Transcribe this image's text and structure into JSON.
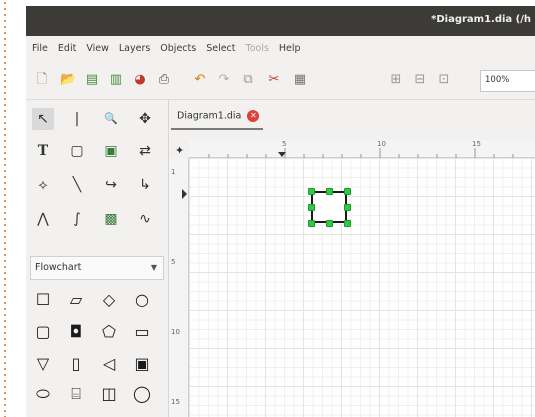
{
  "window": {
    "title": "*Diagram1.dia (/h"
  },
  "menubar": {
    "items": [
      {
        "label": "File",
        "enabled": true
      },
      {
        "label": "Edit",
        "enabled": true
      },
      {
        "label": "View",
        "enabled": true
      },
      {
        "label": "Layers",
        "enabled": true
      },
      {
        "label": "Objects",
        "enabled": true
      },
      {
        "label": "Select",
        "enabled": true
      },
      {
        "label": "Tools",
        "enabled": false
      },
      {
        "label": "Help",
        "enabled": true
      }
    ]
  },
  "toolbar": {
    "zoom_value": "100%",
    "buttons": [
      "new-icon",
      "open-icon",
      "save-icon",
      "save-as-icon",
      "export-icon",
      "print-icon",
      "undo-icon",
      "redo-icon",
      "copy-icon",
      "cut-icon",
      "paste-icon",
      "zoom-in-icon",
      "zoom-out-icon",
      "zoom-fit-icon"
    ]
  },
  "toolbox": {
    "tools": [
      {
        "name": "pointer-tool-icon",
        "glyph": "↖"
      },
      {
        "name": "text-edit-tool-icon",
        "glyph": "|"
      },
      {
        "name": "magnify-tool-icon",
        "glyph": "🔍"
      },
      {
        "name": "scroll-tool-icon",
        "glyph": "✥"
      },
      {
        "name": "text-tool-icon",
        "glyph": "T"
      },
      {
        "name": "box-tool-icon",
        "glyph": "▢"
      },
      {
        "name": "image-tool-icon",
        "glyph": "▣"
      },
      {
        "name": "outline-tool-icon",
        "glyph": "⇄"
      },
      {
        "name": "polygon-tool-icon",
        "glyph": "⟡"
      },
      {
        "name": "line-tool-icon",
        "glyph": "╲"
      },
      {
        "name": "arc-tool-icon",
        "glyph": "↪"
      },
      {
        "name": "zigzag-tool-icon",
        "glyph": "↳"
      },
      {
        "name": "polyline-tool-icon",
        "glyph": "⋀"
      },
      {
        "name": "bezier-tool-icon",
        "glyph": "∫"
      },
      {
        "name": "beziergon-tool-icon",
        "glyph": "▩"
      },
      {
        "name": "freehand-tool-icon",
        "glyph": "∿"
      }
    ],
    "sheet_selector": "Flowchart",
    "shapes": [
      {
        "name": "process-shape-icon",
        "glyph": "☐"
      },
      {
        "name": "parallelogram-shape-icon",
        "glyph": "▱"
      },
      {
        "name": "decision-shape-icon",
        "glyph": "◇"
      },
      {
        "name": "ellipse-shape-icon",
        "glyph": "○"
      },
      {
        "name": "alternate-process-shape-icon",
        "glyph": "▢"
      },
      {
        "name": "delay-shape-icon",
        "glyph": "◘"
      },
      {
        "name": "offpage-connector-shape-icon",
        "glyph": "⬠"
      },
      {
        "name": "card-shape-icon",
        "glyph": "▭"
      },
      {
        "name": "merge-shape-icon",
        "glyph": "▽"
      },
      {
        "name": "predefined-process-shape-icon",
        "glyph": "▯"
      },
      {
        "name": "display-shape-icon",
        "glyph": "◁"
      },
      {
        "name": "internal-storage-shape-icon",
        "glyph": "▣"
      },
      {
        "name": "terminator-shape-icon",
        "glyph": "⬭"
      },
      {
        "name": "magnetic-disk-shape-icon",
        "glyph": "⌸"
      },
      {
        "name": "direct-access-storage-shape-icon",
        "glyph": "◫"
      },
      {
        "name": "sequential-storage-shape-icon",
        "glyph": "◯"
      }
    ]
  },
  "document": {
    "tab_label": "Diagram1.dia",
    "ruler_h_labels": [
      "5",
      "10",
      "15"
    ],
    "ruler_v_labels": [
      "1",
      "5",
      "10",
      "15"
    ],
    "object": {
      "type": "box",
      "selected": true
    }
  },
  "colors": {
    "titlebar": "#3c3b37",
    "selection_handle": "#2ecc40",
    "tab_close": "#e0403a"
  }
}
